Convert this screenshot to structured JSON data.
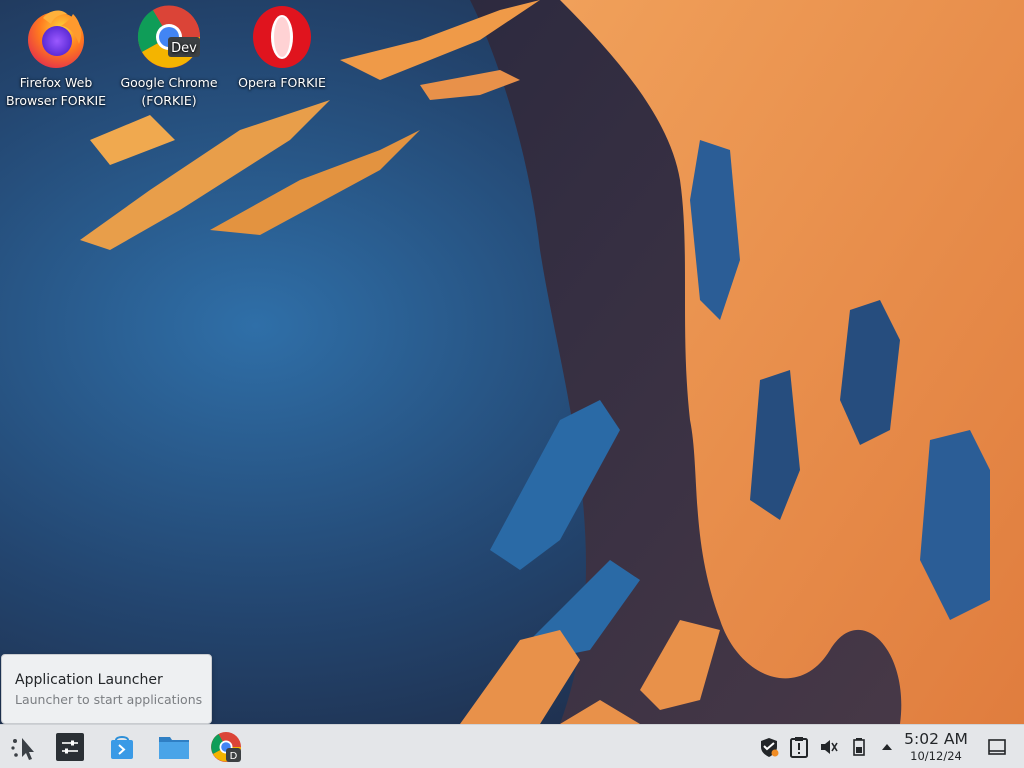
{
  "desktop": {
    "icons": [
      {
        "label": "Firefox Web Browser FORKIE",
        "icon": "firefox-icon"
      },
      {
        "label": "Google Chrome (FORKIE)",
        "icon": "chrome-dev-icon",
        "badge": "Dev"
      },
      {
        "label": "Opera FORKIE",
        "icon": "opera-icon"
      }
    ]
  },
  "tooltip": {
    "title": "Application Launcher",
    "subtitle": "Launcher to start applications"
  },
  "taskbar": {
    "pinned": [
      {
        "name": "application-launcher",
        "icon": "kde-launcher-icon"
      },
      {
        "name": "system-settings",
        "icon": "settings-sliders-icon"
      },
      {
        "name": "discover",
        "icon": "software-center-icon"
      },
      {
        "name": "dolphin",
        "icon": "folder-icon"
      },
      {
        "name": "chrome-dev",
        "icon": "chrome-dev-icon",
        "badge": "D"
      }
    ],
    "tray": [
      {
        "name": "security",
        "icon": "shield-icon"
      },
      {
        "name": "notifications",
        "icon": "clipboard-alert-icon"
      },
      {
        "name": "volume",
        "icon": "volume-muted-icon"
      },
      {
        "name": "battery",
        "icon": "battery-icon"
      },
      {
        "name": "show-hidden",
        "icon": "chevron-up-icon"
      }
    ],
    "clock": {
      "time": "5:02 AM",
      "date": "10/12/24"
    }
  },
  "colors": {
    "taskbar_bg": "#e4e6e9",
    "wallpaper_orange": "#e8914a",
    "wallpaper_blue": "#2a6aa6",
    "opera_red": "#e0141e"
  }
}
